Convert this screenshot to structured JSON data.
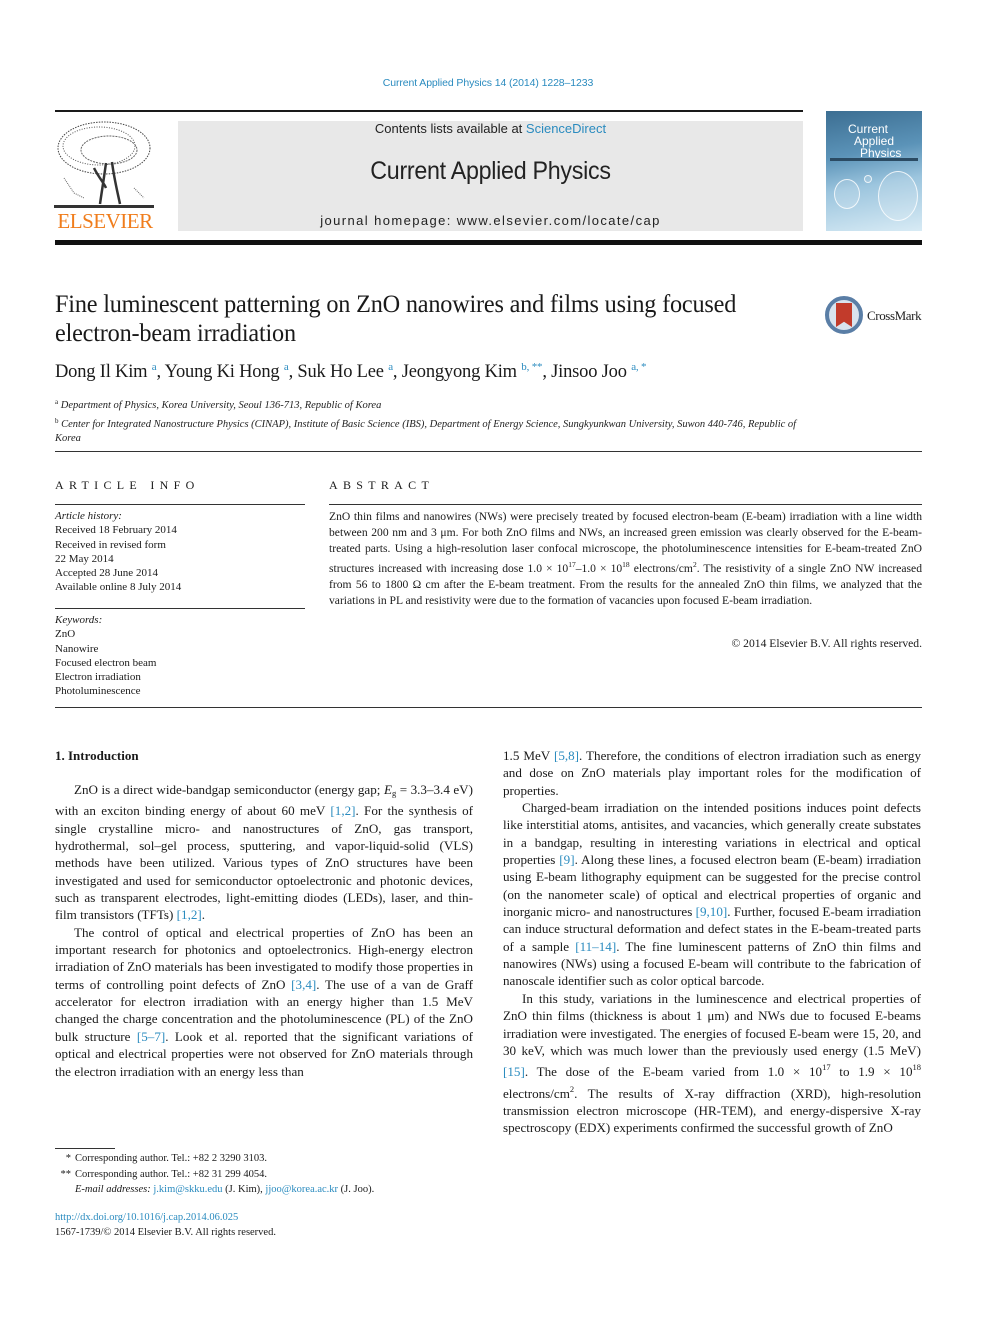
{
  "citation": "Current Applied Physics 14 (2014) 1228–1233",
  "masthead": {
    "publisher_logo_text": "ELSEVIER",
    "contents_prefix": "Contents lists available at ",
    "contents_link": "ScienceDirect",
    "journal_title": "Current Applied Physics",
    "homepage": "journal homepage: www.elsevier.com/locate/cap",
    "cover_title_lines": [
      "Current",
      "Applied",
      "Physics"
    ]
  },
  "article": {
    "title": "Fine luminescent patterning on ZnO nanowires and films using focused electron-beam irradiation",
    "crossmark_label": "CrossMark",
    "authors": [
      {
        "name": "Dong Il Kim",
        "marks": "a"
      },
      {
        "name": "Young Ki Hong",
        "marks": "a"
      },
      {
        "name": "Suk Ho Lee",
        "marks": "a"
      },
      {
        "name": "Jeongyong Kim",
        "marks": "b, **"
      },
      {
        "name": "Jinsoo Joo",
        "marks": "a, *"
      }
    ],
    "affiliations": [
      {
        "mark": "a",
        "text": "Department of Physics, Korea University, Seoul 136-713, Republic of Korea"
      },
      {
        "mark": "b",
        "text": "Center for Integrated Nanostructure Physics (CINAP), Institute of Basic Science (IBS), Department of Energy Science, Sungkyunkwan University, Suwon 440-746, Republic of Korea"
      }
    ]
  },
  "article_info": {
    "heading": "ARTICLE INFO",
    "history_label": "Article history:",
    "history": [
      "Received 18 February 2014",
      "Received in revised form",
      "22 May 2014",
      "Accepted 28 June 2014",
      "Available online 8 July 2014"
    ],
    "keywords_label": "Keywords:",
    "keywords": [
      "ZnO",
      "Nanowire",
      "Focused electron beam",
      "Electron irradiation",
      "Photoluminescence"
    ]
  },
  "abstract": {
    "heading": "ABSTRACT",
    "part1": "ZnO thin films and nanowires (NWs) were precisely treated by focused electron-beam (E-beam) irradiation with a line width between 200 nm and 3 μm. For both ZnO films and NWs, an increased green emission was clearly observed for the E-beam-treated parts. Using a high-resolution laser confocal microscope, the photoluminescence intensities for E-beam-treated ZnO structures increased with increasing dose 1.0 × 10",
    "exp1": "17",
    "part2": "–1.0 × 10",
    "exp2": "18",
    "part3": " electrons/cm",
    "exp3": "2",
    "part4": ". The resistivity of a single ZnO NW increased from 56 to 1800 Ω cm after the E-beam treatment. From the results for the annealed ZnO thin films, we analyzed that the variations in PL and resistivity were due to the formation of vacancies upon focused E-beam irradiation.",
    "copyright": "© 2014 Elsevier B.V. All rights reserved."
  },
  "introduction": {
    "heading": "1.  Introduction",
    "p1": {
      "a": "ZnO is a direct wide-bandgap semiconductor (energy gap; ",
      "eg": "E",
      "eg_sub": "g",
      "b": " = 3.3–3.4 eV) with an exciton binding energy of about 60 meV ",
      "ref1": "[1,2]",
      "c": ". For the synthesis of single crystalline micro- and nanostructures of ZnO, gas transport, hydrothermal, sol–gel process, sputtering, and vapor-liquid-solid (VLS) methods have been utilized. Various types of ZnO structures have been investigated and used for semiconductor optoelectronic and photonic devices, such as transparent electrodes, light-emitting diodes (LEDs), laser, and thin-film transistors (TFTs) ",
      "ref2": "[1,2]",
      "d": "."
    },
    "p2": {
      "a": "The control of optical and electrical properties of ZnO has been an important research for photonics and optoelectronics. High-energy electron irradiation of ZnO materials has been investigated to modify those properties in terms of controlling point defects of ZnO ",
      "ref1": "[3,4]",
      "b": ". The use of a van de Graff accelerator for electron irradiation with an energy higher than 1.5 MeV changed the charge concentration and the photoluminescence (PL) of the ZnO bulk structure ",
      "ref2": "[5–7]",
      "c": ". Look et al. reported that the significant variations of optical and electrical properties were not observed for ZnO materials through the electron irradiation with an energy less than"
    },
    "p2_cont": {
      "a": "1.5 MeV ",
      "ref1": "[5,8]",
      "b": ". Therefore, the conditions of electron irradiation such as energy and dose on ZnO materials play important roles for the modification of properties."
    },
    "p3": {
      "a": "Charged-beam irradiation on the intended positions induces point defects like interstitial atoms, antisites, and vacancies, which generally create substates in a bandgap, resulting in interesting variations in electrical and optical properties ",
      "ref1": "[9]",
      "b": ". Along these lines, a focused electron beam (E-beam) irradiation using E-beam lithography equipment can be suggested for the precise control (on the nanometer scale) of optical and electrical properties of organic and inorganic micro- and nanostructures ",
      "ref2": "[9,10]",
      "c": ". Further, focused E-beam irradiation can induce structural deformation and defect states in the E-beam-treated parts of a sample ",
      "ref3": "[11–14]",
      "d": ". The fine luminescent patterns of ZnO thin films and nanowires (NWs) using a focused E-beam will contribute to the fabrication of nanoscale identifier such as color optical barcode."
    },
    "p4": {
      "a": "In this study, variations in the luminescence and electrical properties of ZnO thin films (thickness is about 1 μm) and NWs due to focused E-beams irradiation were investigated. The energies of focused E-beam were 15, 20, and 30 keV, which was much lower than the previously used energy (1.5 MeV) ",
      "ref1": "[15]",
      "b": ". The dose of the E-beam varied from 1.0 × 10",
      "exp1": "17",
      "c": " to 1.9 × 10",
      "exp2": "18",
      "d": " electrons/cm",
      "exp3": "2",
      "e": ". The results of X-ray diffraction (XRD), high-resolution transmission electron microscope (HR-TEM), and energy-dispersive X-ray spectroscopy (EDX) experiments confirmed the successful growth of ZnO"
    }
  },
  "footnotes": {
    "fn1_mark": "*",
    "fn1_text": "Corresponding author. Tel.: +82 2 3290 3103.",
    "fn2_mark": "**",
    "fn2_text": "Corresponding author. Tel.: +82 31 299 4054.",
    "email_label": "E-mail addresses: ",
    "email1": "j.kim@skku.edu",
    "email1_who": " (J. Kim), ",
    "email2": "jjoo@korea.ac.kr",
    "email2_who": " (J. Joo)."
  },
  "doi": "http://dx.doi.org/10.1016/j.cap.2014.06.025",
  "issn_line": "1567-1739/© 2014 Elsevier B.V. All rights reserved.",
  "colors": {
    "link": "#2a8bbf",
    "elsevier_orange": "#f07d1c",
    "masthead_gray": "#e8e8e8"
  }
}
